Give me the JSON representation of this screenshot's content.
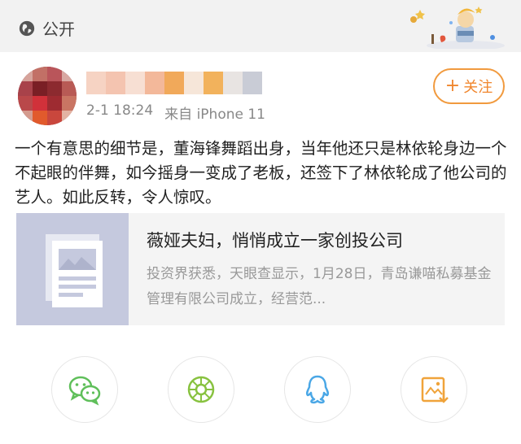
{
  "header": {
    "visibility_label": "公开",
    "visibility_icon": "globe-icon"
  },
  "post": {
    "meta_time": "2-1 18:24",
    "meta_source": "来自 iPhone 11",
    "follow_label": "关注",
    "follow_icon": "plus-icon",
    "text": "一个有意思的细节是，董海锋舞蹈出身，当年他还只是林依轮身边一个不起眼的伴舞，如今摇身一变成了老板，还签下了林依轮成了他公司的艺人。如此反转，令人惊叹。"
  },
  "link_card": {
    "title": "薇娅夫妇，悄悄成立一家创投公司",
    "description": "投资界获悉，天眼查显示，1月28日，青岛谦喵私募基金管理有限公司成立，经营范..."
  },
  "share": {
    "items": [
      {
        "icon": "wechat-icon",
        "color": "#5fbf5a"
      },
      {
        "icon": "moments-icon",
        "color": "#88c240"
      },
      {
        "icon": "qq-icon",
        "color": "#4aa7e6"
      },
      {
        "icon": "save-image-icon",
        "color": "#f0a33a"
      }
    ]
  },
  "colors": {
    "accent": "#f0862d",
    "muted_text": "#888888"
  }
}
